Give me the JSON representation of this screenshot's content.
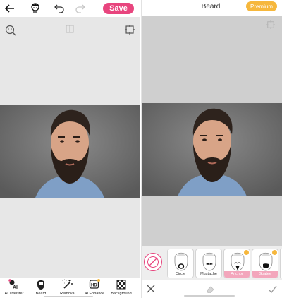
{
  "left": {
    "save_label": "Save",
    "tools": [
      {
        "label": "AI Transfer",
        "icon": "ai-transfer-icon"
      },
      {
        "label": "Beard",
        "icon": "beard-icon"
      },
      {
        "label": "Removal",
        "icon": "magic-wand-icon"
      },
      {
        "label": "AI Enhance",
        "icon": "hd-enhance-icon"
      },
      {
        "label": "Background",
        "icon": "background-grid-icon"
      }
    ],
    "ai_enhance_badge": "",
    "ai_transfer_badge": ""
  },
  "right": {
    "title": "Beard",
    "premium_label": "Premium",
    "styles": [
      {
        "label": "Circle",
        "premium": false
      },
      {
        "label": "Mustache",
        "premium": false
      },
      {
        "label": "Anchor",
        "premium": true
      },
      {
        "label": "Goatee",
        "premium": true
      }
    ]
  },
  "colors": {
    "accent_pink": "#e8457e",
    "premium_gold": "#f6b73c",
    "premium_label_bg": "#f3a6bc"
  }
}
